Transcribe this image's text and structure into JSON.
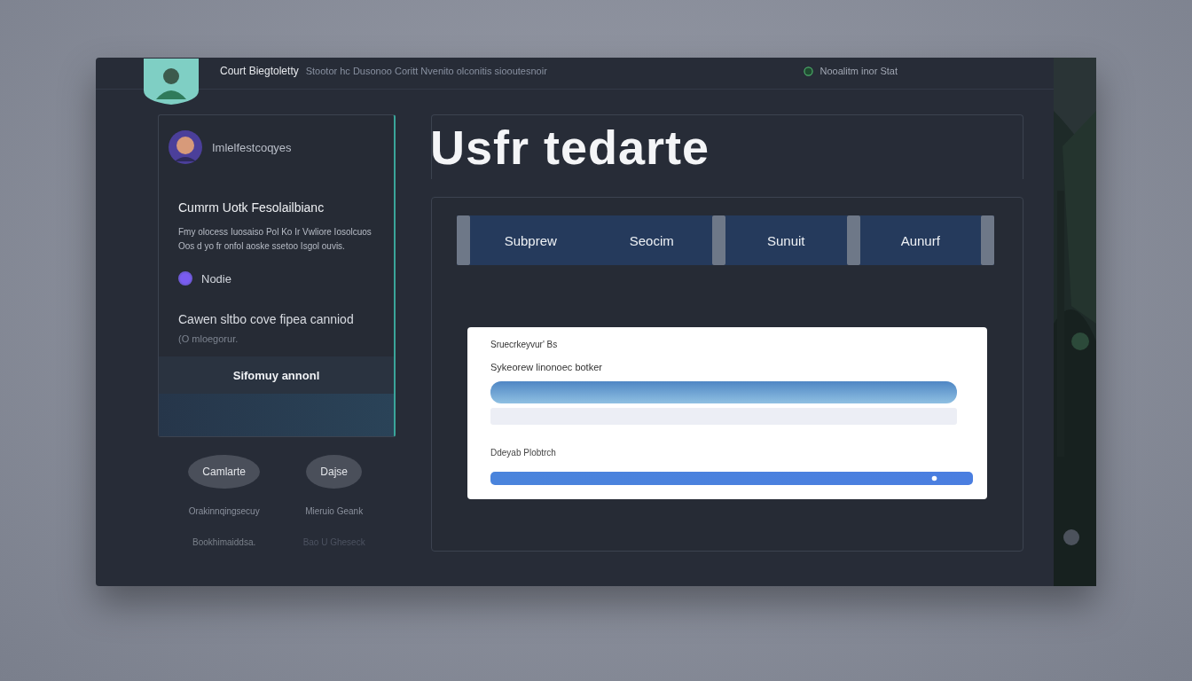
{
  "header": {
    "title": "Court Biegtoletty",
    "subtitle": "Stootor hc Dusonoo Coritt Nvenito olconitis siooutesnoir",
    "status": "Nooalitm inor Stat"
  },
  "sidebar": {
    "profile_name": "Imlelfestcoqyes",
    "heading": "Cumrm Uotk Fesolailbianc",
    "paragraph": "Fmy olocess Iuosaiso Pol Ko Ir Vwliore Iosolcuos Oos d yo fr onfol aoske ssetoo Isgol ouvis.",
    "option": {
      "label": "Nodie",
      "checked": true
    },
    "note_title": "Cawen sltbo cove fipea canniod",
    "note_sub": "(O mloegorur.",
    "action": "Sifomuy annonl"
  },
  "buttons": [
    {
      "label": "Camlarte",
      "caption": "Orakinnqingsecuy",
      "sub": "Bookhimaiddsa."
    },
    {
      "label": "Dajse",
      "caption": "Mieruio Geank",
      "sub": "Bao U Gheseck"
    }
  ],
  "main": {
    "title": "Usfr tedarte",
    "tabs": [
      {
        "label": "Subprew",
        "selected": false
      },
      {
        "label": "Seocim",
        "selected": false
      },
      {
        "label": "Sunuit",
        "selected": false
      },
      {
        "label": "Aunurf",
        "selected": false
      }
    ],
    "card": {
      "label": "Sruecrkeyvur' Bs",
      "field_label": "Sykeorew linonoec botker",
      "section_label": "Ddeyab Plobtrch"
    }
  }
}
